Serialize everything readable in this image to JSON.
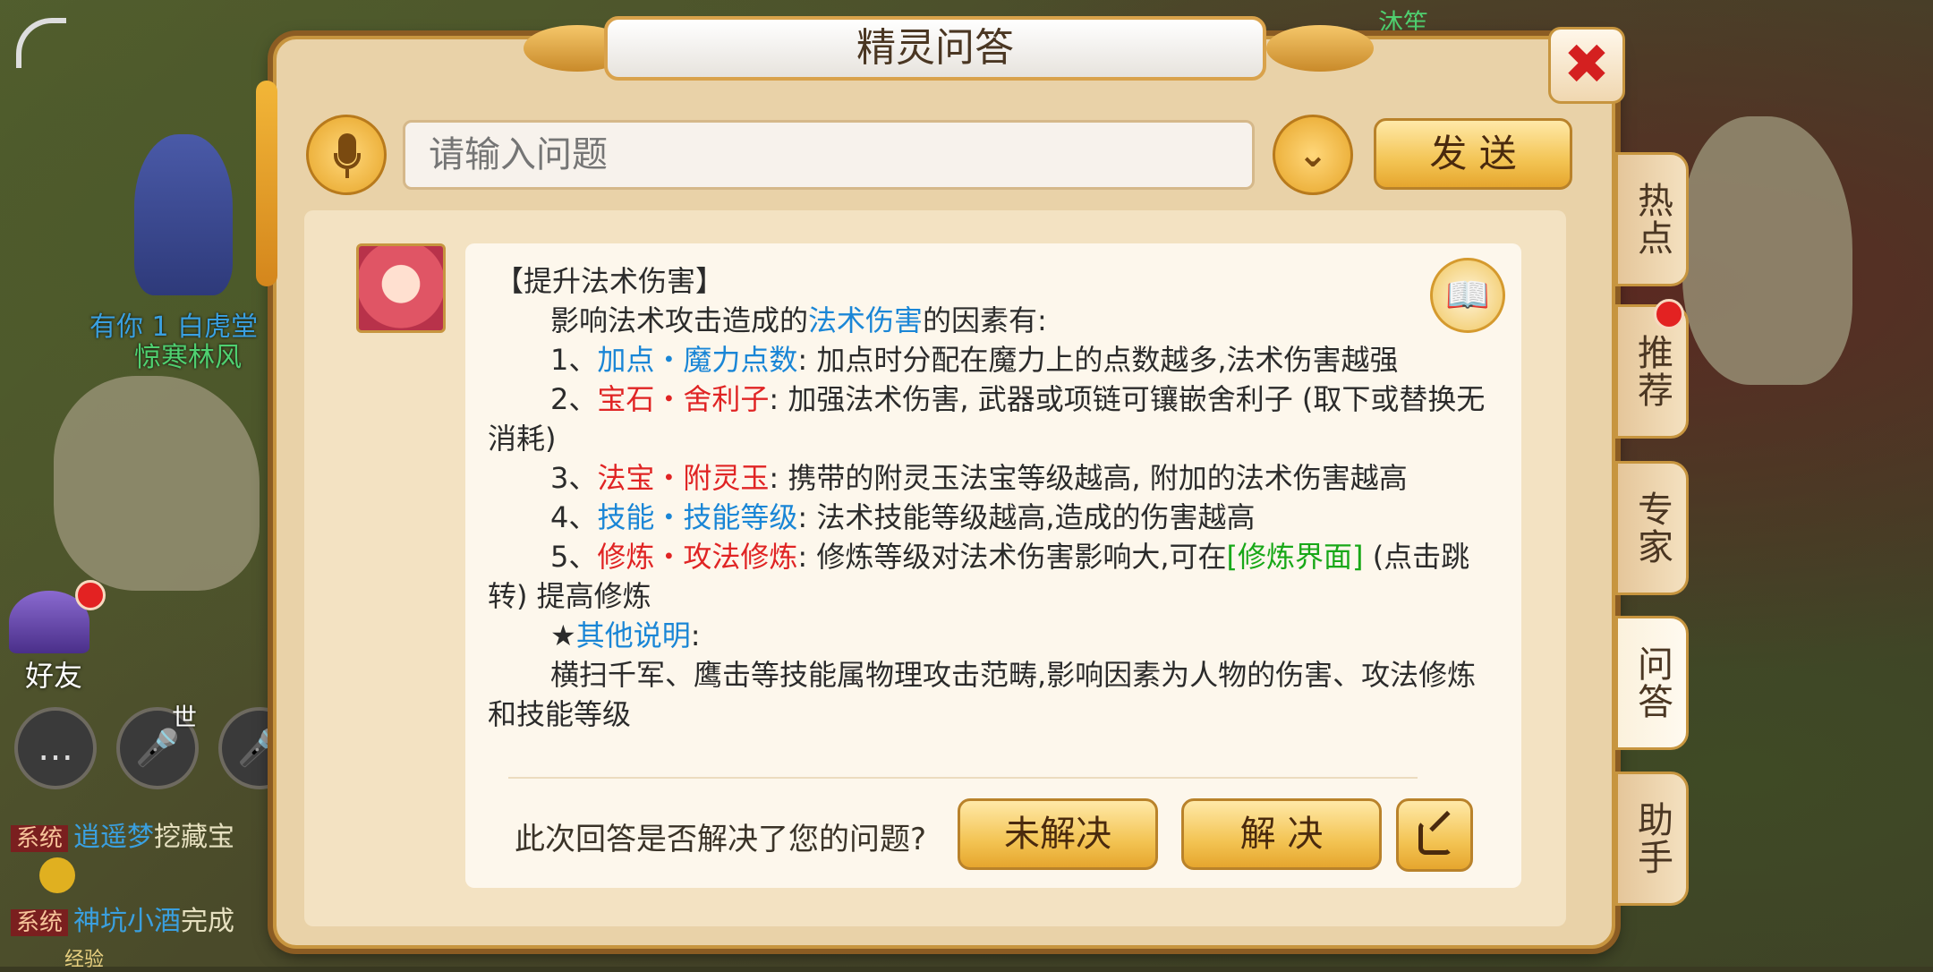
{
  "panel": {
    "title": "精灵问答",
    "close_label": "✖",
    "input_placeholder": "请输入问题",
    "dropdown_label": "⌄",
    "send_label": "发 送"
  },
  "side_tabs": [
    {
      "label": "热点"
    },
    {
      "label": "推荐"
    },
    {
      "label": "专家"
    },
    {
      "label": "问答"
    },
    {
      "label": "助手"
    }
  ],
  "answer": {
    "heading": "【提升法术伤害】",
    "intro_prefix": "影响法术攻击造成的",
    "intro_highlight": "法术伤害",
    "intro_suffix": "的因素有:",
    "items": [
      {
        "num": "1、",
        "term": "加点・魔力点数",
        "desc": ": 加点时分配在魔力上的点数越多,法术伤害越强"
      },
      {
        "num": "2、",
        "term": "宝石・舍利子",
        "desc": ": 加强法术伤害, 武器或项链可镶嵌舍利子 (取下或替换无消耗)"
      },
      {
        "num": "3、",
        "term": "法宝・附灵玉",
        "desc": ": 携带的附灵玉法宝等级越高, 附加的法术伤害越高"
      },
      {
        "num": "4、",
        "term": "技能・技能等级",
        "desc": ": 法术技能等级越高,造成的伤害越高"
      },
      {
        "num": "5、",
        "term": "修炼・攻法修炼",
        "desc": ": 修炼等级对法术伤害影响大,可在",
        "link": "[修炼界面]",
        "desc_after": " (点击跳转) 提高修炼"
      }
    ],
    "other_star": "★",
    "other_title": "其他说明",
    "other_colon": ":",
    "other_text": "横扫千军、鹰击等技能属物理攻击范畴,影响因素为人物的伤害、攻法修炼和技能等级"
  },
  "feedback": {
    "question": "此次回答是否解决了您的问题?",
    "unresolved_label": "未解决",
    "resolved_label": "解 决",
    "share_icon": "share-icon"
  },
  "game_bg": {
    "name_left_top": "有你 1 白虎堂",
    "name_left_bottom": "惊寒林风",
    "friends_label": "好友",
    "world_label": "世",
    "chat_lines": [
      {
        "tag": "系统",
        "name": "逍遥梦",
        "text": "挖藏宝"
      },
      {
        "tag": "系统",
        "name": "神坑小酒",
        "text": "完成"
      }
    ],
    "exp_label": "经验",
    "top_name": "沐笙"
  },
  "colors": {
    "accent_blue": "#1a86d6",
    "accent_red": "#e02424",
    "accent_green": "#18a818",
    "button_gold": "#f3c454"
  }
}
